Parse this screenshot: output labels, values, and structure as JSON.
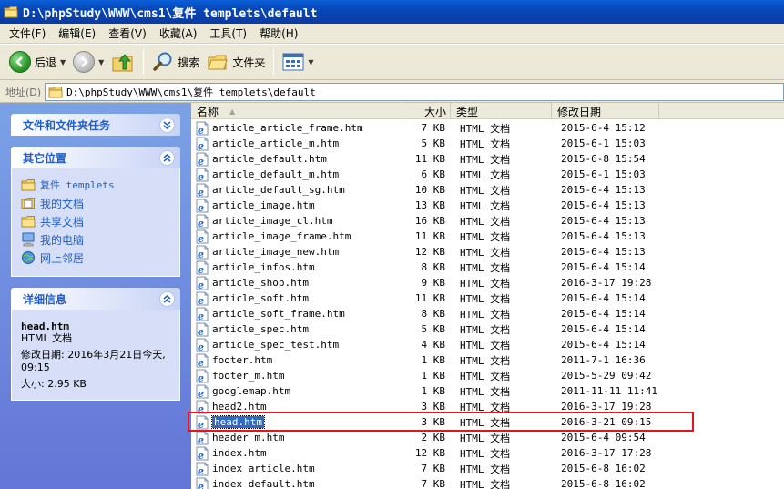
{
  "window": {
    "title": "D:\\phpStudy\\WWW\\cms1\\复件 templets\\default"
  },
  "menu": [
    "文件(F)",
    "编辑(E)",
    "查看(V)",
    "收藏(A)",
    "工具(T)",
    "帮助(H)"
  ],
  "toolbar": {
    "back_label": "后退",
    "search_label": "搜索",
    "folders_label": "文件夹"
  },
  "address": {
    "label": "地址(D)",
    "path": "D:\\phpStudy\\WWW\\cms1\\复件 templets\\default"
  },
  "tasks": {
    "title": "文件和文件夹任务"
  },
  "places": {
    "title": "其它位置",
    "items": [
      {
        "label": "复件 templets",
        "icon": "folder-icon"
      },
      {
        "label": "我的文档",
        "icon": "my-documents-icon"
      },
      {
        "label": "共享文档",
        "icon": "shared-documents-icon"
      },
      {
        "label": "我的电脑",
        "icon": "my-computer-icon"
      },
      {
        "label": "网上邻居",
        "icon": "network-places-icon"
      }
    ]
  },
  "details": {
    "title": "详细信息",
    "name": "head.htm",
    "type": "HTML 文档",
    "modified": "修改日期: 2016年3月21日今天, 09:15",
    "size": "大小: 2.95 KB"
  },
  "columns": {
    "name": "名称",
    "size": "大小",
    "type": "类型",
    "date": "修改日期"
  },
  "files": [
    {
      "name": "article_article_frame.htm",
      "size": "7 KB",
      "type": "HTML 文档",
      "date": "2015-6-4 15:12"
    },
    {
      "name": "article_article_m.htm",
      "size": "5 KB",
      "type": "HTML 文档",
      "date": "2015-6-1 15:03"
    },
    {
      "name": "article_default.htm",
      "size": "11 KB",
      "type": "HTML 文档",
      "date": "2015-6-8 15:54"
    },
    {
      "name": "article_default_m.htm",
      "size": "6 KB",
      "type": "HTML 文档",
      "date": "2015-6-1 15:03"
    },
    {
      "name": "article_default_sg.htm",
      "size": "10 KB",
      "type": "HTML 文档",
      "date": "2015-6-4 15:13"
    },
    {
      "name": "article_image.htm",
      "size": "13 KB",
      "type": "HTML 文档",
      "date": "2015-6-4 15:13"
    },
    {
      "name": "article_image_cl.htm",
      "size": "16 KB",
      "type": "HTML 文档",
      "date": "2015-6-4 15:13"
    },
    {
      "name": "article_image_frame.htm",
      "size": "11 KB",
      "type": "HTML 文档",
      "date": "2015-6-4 15:13"
    },
    {
      "name": "article_image_new.htm",
      "size": "12 KB",
      "type": "HTML 文档",
      "date": "2015-6-4 15:13"
    },
    {
      "name": "article_infos.htm",
      "size": "8 KB",
      "type": "HTML 文档",
      "date": "2015-6-4 15:14"
    },
    {
      "name": "article_shop.htm",
      "size": "9 KB",
      "type": "HTML 文档",
      "date": "2016-3-17 19:28"
    },
    {
      "name": "article_soft.htm",
      "size": "11 KB",
      "type": "HTML 文档",
      "date": "2015-6-4 15:14"
    },
    {
      "name": "article_soft_frame.htm",
      "size": "8 KB",
      "type": "HTML 文档",
      "date": "2015-6-4 15:14"
    },
    {
      "name": "article_spec.htm",
      "size": "5 KB",
      "type": "HTML 文档",
      "date": "2015-6-4 15:14"
    },
    {
      "name": "article_spec_test.htm",
      "size": "4 KB",
      "type": "HTML 文档",
      "date": "2015-6-4 15:14"
    },
    {
      "name": "footer.htm",
      "size": "1 KB",
      "type": "HTML 文档",
      "date": "2011-7-1 16:36"
    },
    {
      "name": "footer_m.htm",
      "size": "1 KB",
      "type": "HTML 文档",
      "date": "2015-5-29 09:42"
    },
    {
      "name": "googlemap.htm",
      "size": "1 KB",
      "type": "HTML 文档",
      "date": "2011-11-11 11:41"
    },
    {
      "name": "head2.htm",
      "size": "3 KB",
      "type": "HTML 文档",
      "date": "2016-3-17 19:28"
    },
    {
      "name": "head.htm",
      "size": "3 KB",
      "type": "HTML 文档",
      "date": "2016-3-21 09:15",
      "selected": true
    },
    {
      "name": "header_m.htm",
      "size": "2 KB",
      "type": "HTML 文档",
      "date": "2015-6-4 09:54"
    },
    {
      "name": "index.htm",
      "size": "12 KB",
      "type": "HTML 文档",
      "date": "2016-3-17 17:28"
    },
    {
      "name": "index_article.htm",
      "size": "7 KB",
      "type": "HTML 文档",
      "date": "2015-6-8 16:02"
    },
    {
      "name": "index_default.htm",
      "size": "7 KB",
      "type": "HTML 文档",
      "date": "2015-6-8 16:02"
    }
  ],
  "colors": {
    "highlight": "#e8141b",
    "selection": "#316ac5",
    "link": "#215dc6"
  }
}
